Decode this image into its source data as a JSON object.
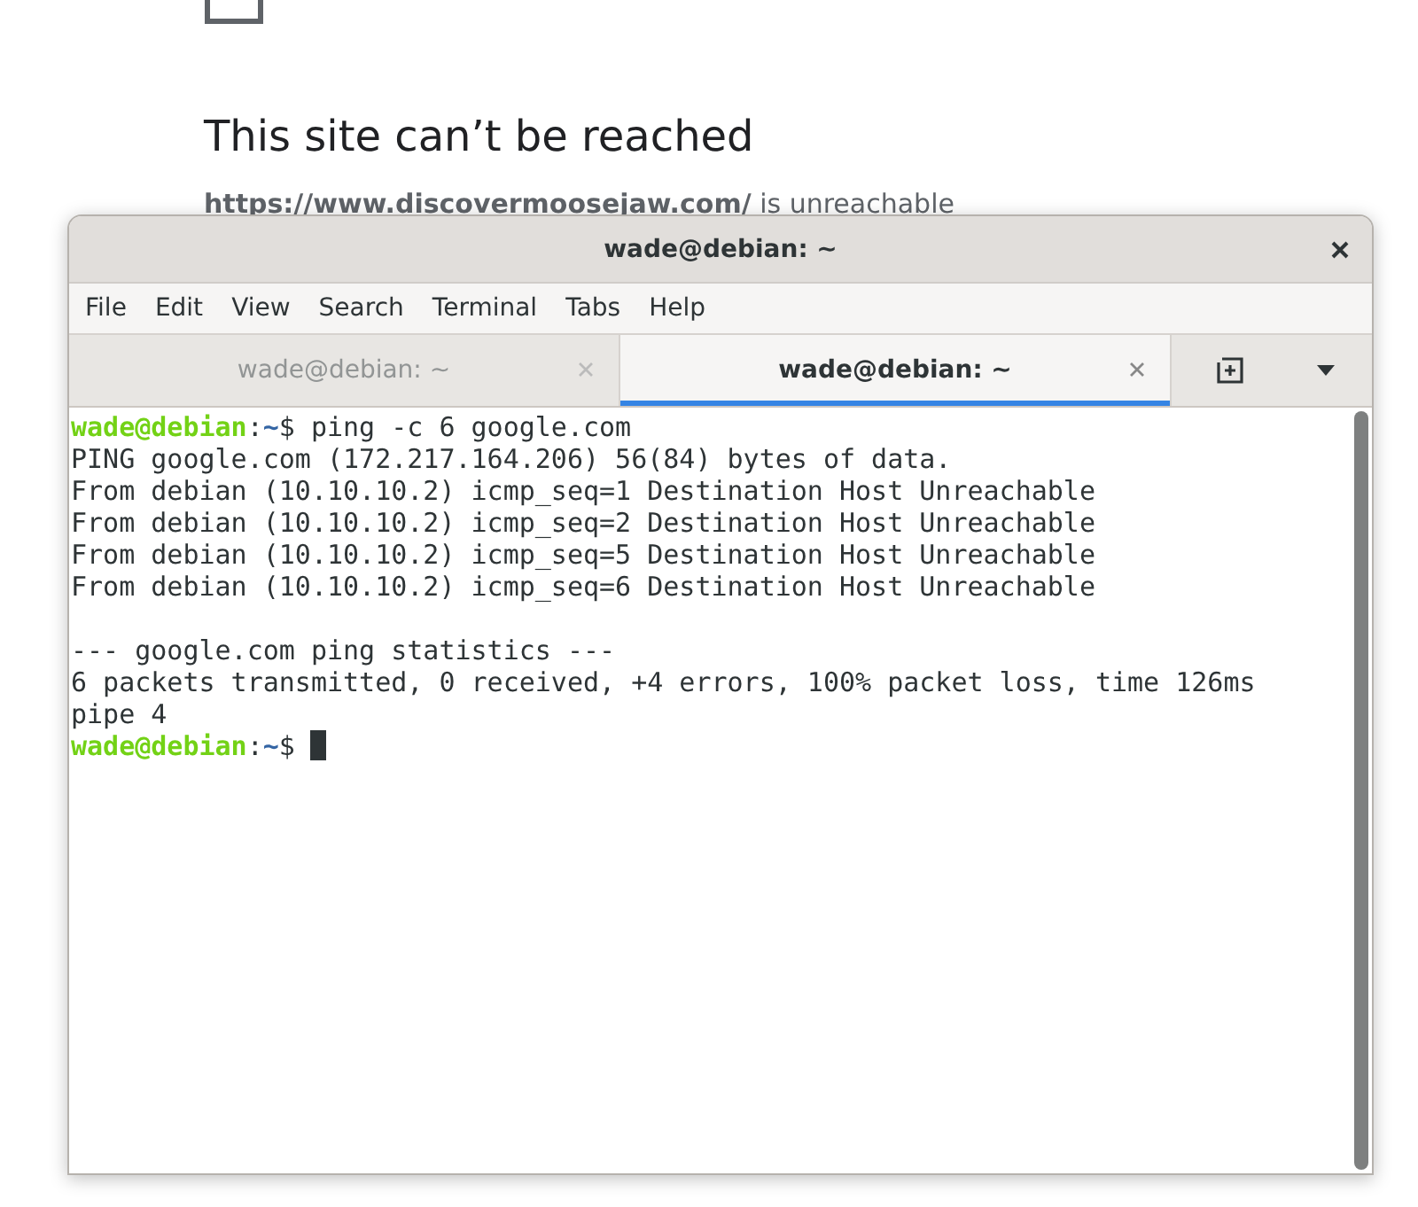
{
  "browser_page": {
    "heading": "This site can’t be reached",
    "message_link": "https://www.discovermoosejaw.com/",
    "message_rest": " is unreachable"
  },
  "window": {
    "title": "wade@debian: ~"
  },
  "menu": [
    "File",
    "Edit",
    "View",
    "Search",
    "Terminal",
    "Tabs",
    "Help"
  ],
  "tabs": [
    {
      "label": "wade@debian: ~",
      "selected": false
    },
    {
      "label": "wade@debian: ~",
      "selected": true
    }
  ],
  "lines": [
    {
      "kind": "prompt",
      "user_host": "wade@debian",
      "sep": ":",
      "path": "~",
      "sign": "$",
      "command": " ping -c 6 google.com",
      "cursor": false
    },
    {
      "kind": "output",
      "text": "PING google.com (172.217.164.206) 56(84) bytes of data."
    },
    {
      "kind": "output",
      "text": "From debian (10.10.10.2) icmp_seq=1 Destination Host Unreachable"
    },
    {
      "kind": "output",
      "text": "From debian (10.10.10.2) icmp_seq=2 Destination Host Unreachable"
    },
    {
      "kind": "output",
      "text": "From debian (10.10.10.2) icmp_seq=5 Destination Host Unreachable"
    },
    {
      "kind": "output",
      "text": "From debian (10.10.10.2) icmp_seq=6 Destination Host Unreachable"
    },
    {
      "kind": "blank"
    },
    {
      "kind": "output",
      "text": "--- google.com ping statistics ---"
    },
    {
      "kind": "output",
      "text": "6 packets transmitted, 0 received, +4 errors, 100% packet loss, time 126ms"
    },
    {
      "kind": "output",
      "text": "pipe 4"
    },
    {
      "kind": "prompt",
      "user_host": "wade@debian",
      "sep": ":",
      "path": "~",
      "sign": "$",
      "cursor": true
    }
  ]
}
